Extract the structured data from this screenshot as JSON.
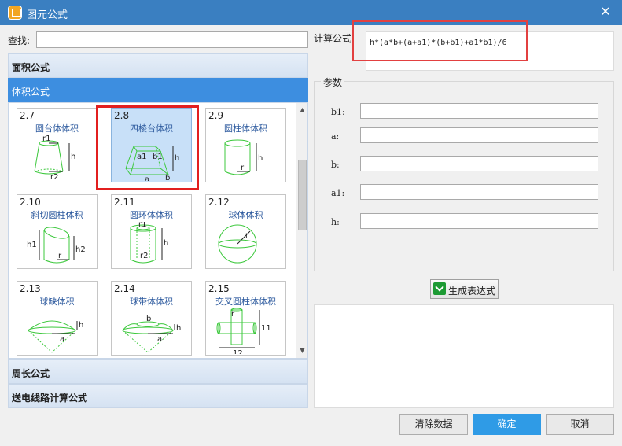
{
  "window": {
    "title": "图元公式",
    "close_glyph": "✕"
  },
  "search": {
    "label": "查找:",
    "value": "",
    "placeholder": ""
  },
  "categories": {
    "area": "面积公式",
    "volume": "体积公式",
    "perimeter": "周长公式",
    "transmission": "送电线路计算公式"
  },
  "tiles": [
    {
      "num": "2.7",
      "name": "圆台体体积",
      "labels": [
        "r1",
        "h",
        "r2"
      ]
    },
    {
      "num": "2.8",
      "name": "四棱台体积",
      "labels": [
        "a1",
        "b1",
        "h",
        "a",
        "b"
      ]
    },
    {
      "num": "2.9",
      "name": "圆柱体体积",
      "labels": [
        "h",
        "r"
      ]
    },
    {
      "num": "2.10",
      "name": "斜切圆柱体积",
      "labels": [
        "h1",
        "h2",
        "r"
      ]
    },
    {
      "num": "2.11",
      "name": "圆环体体积",
      "labels": [
        "r1",
        "h",
        "r2"
      ]
    },
    {
      "num": "2.12",
      "name": "球体体积",
      "labels": [
        "r"
      ]
    },
    {
      "num": "2.13",
      "name": "球缺体积",
      "labels": [
        "h",
        "a"
      ]
    },
    {
      "num": "2.14",
      "name": "球带体体积",
      "labels": [
        "b",
        "h",
        "a"
      ]
    },
    {
      "num": "2.15",
      "name": "交叉圆柱体体积",
      "labels": [
        "r",
        "11",
        "12"
      ]
    }
  ],
  "formula": {
    "label": "计算公式:",
    "value": "h*(a*b+(a+a1)*(b+b1)+a1*b1)/6"
  },
  "params": {
    "legend": "参数",
    "fields": [
      {
        "label": "b1:",
        "value": ""
      },
      {
        "label": "a:",
        "value": ""
      },
      {
        "label": "b:",
        "value": ""
      },
      {
        "label": "a1:",
        "value": ""
      },
      {
        "label": "h:",
        "value": ""
      }
    ]
  },
  "generate_button": "生成表达式",
  "buttons": {
    "clear": "清除数据",
    "ok": "确定",
    "cancel": "取消"
  },
  "colors": {
    "titlebar": "#3a7fc1",
    "accent": "#3d8ee0",
    "shape_green": "#3cc83c",
    "highlight_red": "#e21f1f"
  }
}
